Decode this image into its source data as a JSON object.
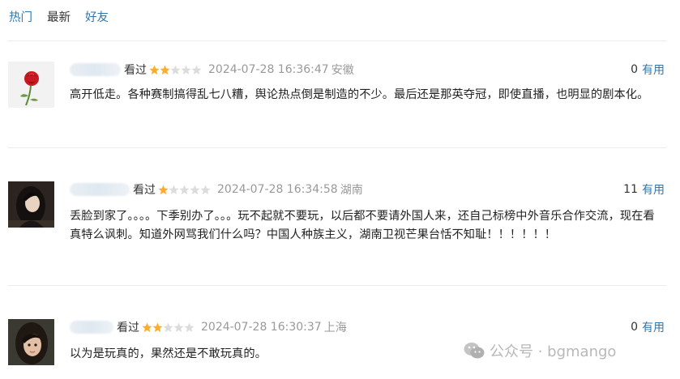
{
  "tabs": [
    {
      "label": "热门"
    },
    {
      "label": "最新"
    },
    {
      "label": "好友"
    }
  ],
  "comments": [
    {
      "watched": "看过",
      "rating": 2,
      "max_rating": 5,
      "time": "2024-07-28 16:36:47",
      "location": "安徽",
      "useful_count": "0",
      "useful_label": "有用",
      "text": "高开低走。各种赛制搞得乱七八糟，舆论热点倒是制造的不少。最后还是那英夺冠，即使直播，也明显的剧本化。",
      "avatar": "rose-avatar"
    },
    {
      "watched": "看过",
      "rating": 1,
      "max_rating": 5,
      "time": "2024-07-28 16:34:58",
      "location": "湖南",
      "useful_count": "11",
      "useful_label": "有用",
      "text": "丢脸到家了。。。。下季别办了。。。玩不起就不要玩，以后都不要请外国人来，还自己标榜中外音乐合作交流，现在看真特么讽刺。知道外网骂我们什么吗？中国人种族主义，湖南卫视芒果台恬不知耻！！！！！！",
      "avatar": "person-avatar"
    },
    {
      "watched": "看过",
      "rating": 2,
      "max_rating": 5,
      "time": "2024-07-28 16:30:37",
      "location": "上海",
      "useful_count": "0",
      "useful_label": "有用",
      "text": "以为是玩真的，果然还是不敢玩真的。",
      "avatar": "girl-avatar"
    }
  ],
  "watermark": {
    "text": "公众号 · bgmango",
    "icon": "wechat-icon"
  },
  "colors": {
    "link": "#3377aa",
    "star_on": "#ffac2d",
    "star_off": "#d9d9d9",
    "meta_gray": "#999999"
  }
}
